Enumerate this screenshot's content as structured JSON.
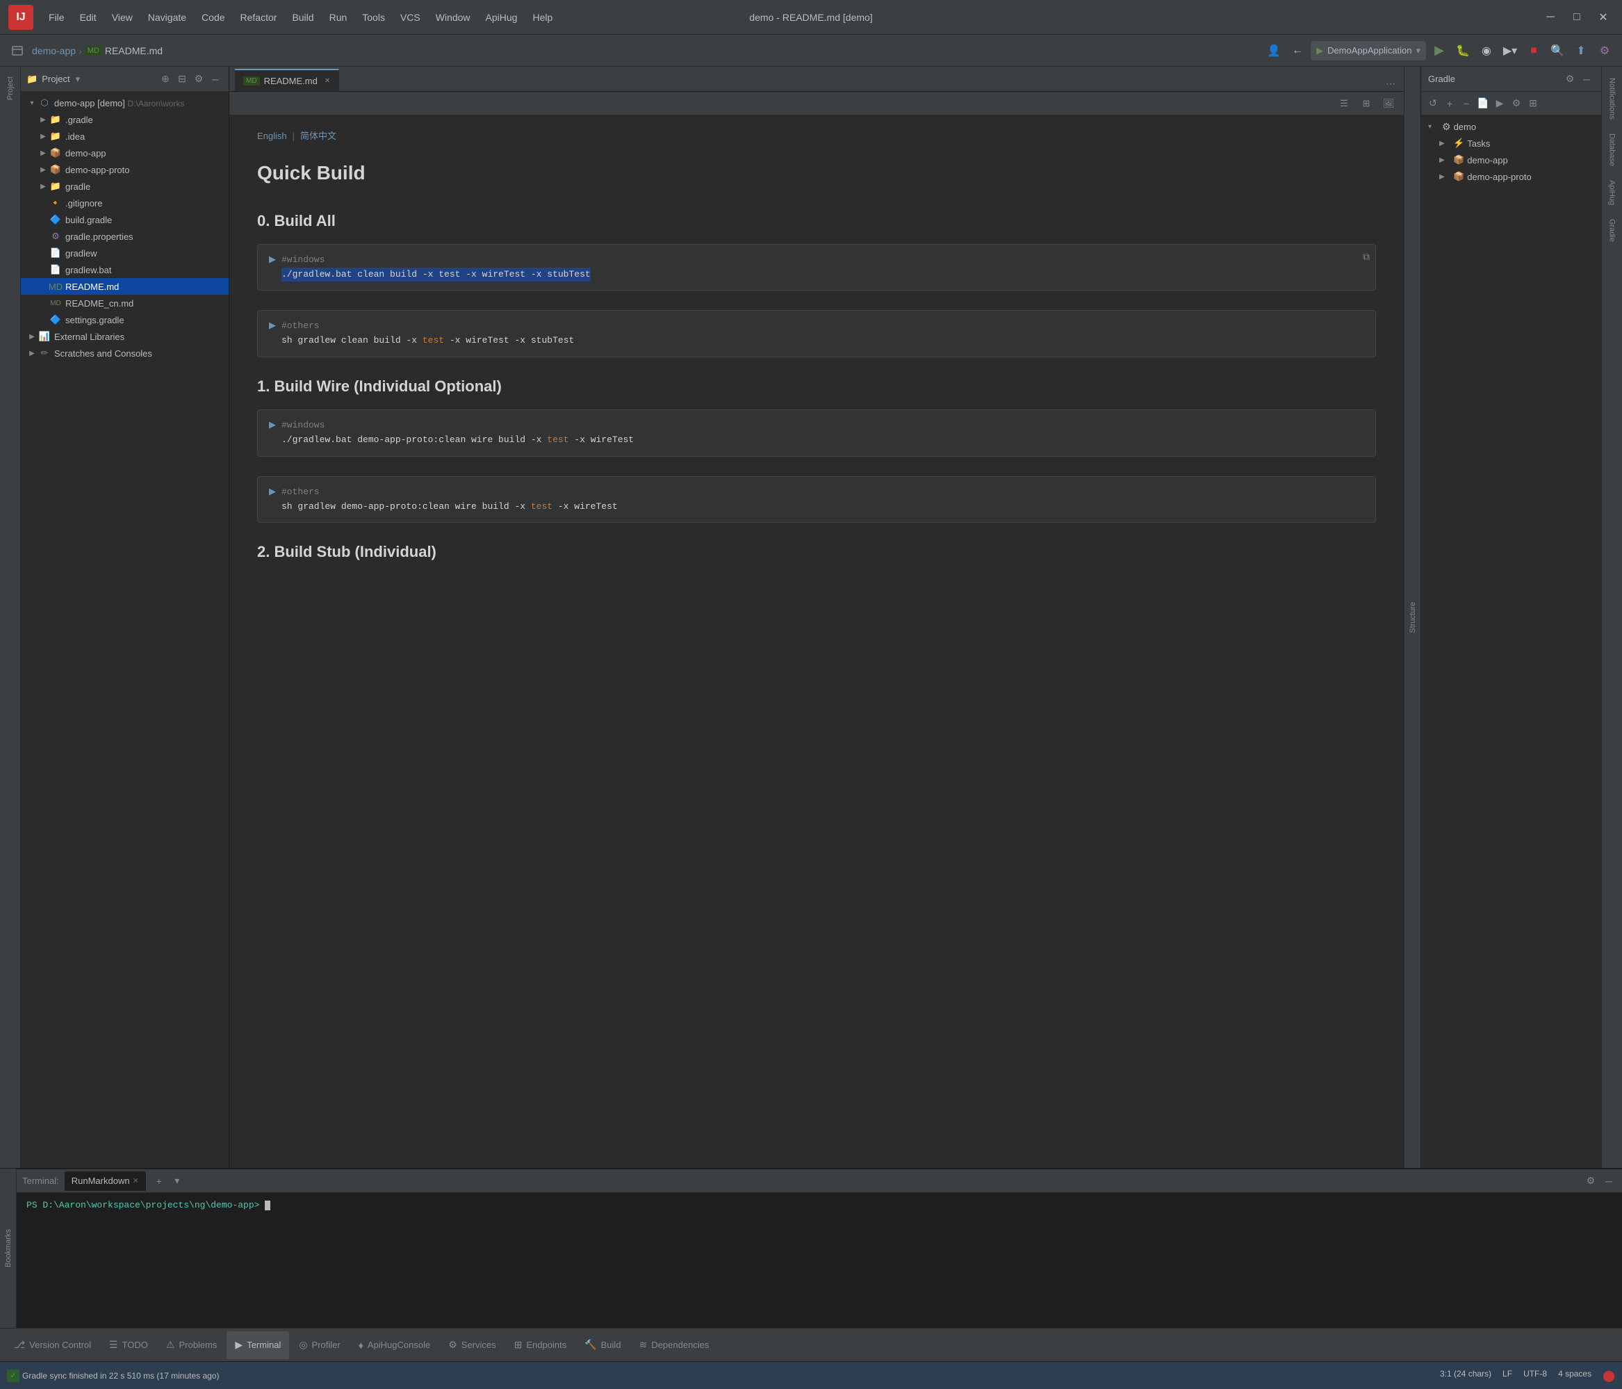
{
  "titleBar": {
    "logo": "IJ",
    "title": "demo - README.md [demo]",
    "menuItems": [
      "File",
      "Edit",
      "View",
      "Navigate",
      "Code",
      "Refactor",
      "Build",
      "Run",
      "Tools",
      "VCS",
      "Window",
      "ApiHug",
      "Help"
    ]
  },
  "navBar": {
    "projectName": "demo-app",
    "fileName": "README.md",
    "appConfig": "DemoAppApplication"
  },
  "projectPanel": {
    "title": "Project",
    "rootNode": {
      "name": "demo-app [demo]",
      "path": "D:\\Aaron\\works"
    },
    "items": [
      {
        "level": 1,
        "name": ".gradle",
        "type": "folder",
        "expanded": false
      },
      {
        "level": 1,
        "name": ".idea",
        "type": "folder",
        "expanded": false
      },
      {
        "level": 1,
        "name": "demo-app",
        "type": "module-folder",
        "expanded": false
      },
      {
        "level": 1,
        "name": "demo-app-proto",
        "type": "module-folder",
        "expanded": false
      },
      {
        "level": 1,
        "name": "gradle",
        "type": "folder",
        "expanded": false
      },
      {
        "level": 1,
        "name": ".gitignore",
        "type": "git",
        "expanded": false
      },
      {
        "level": 1,
        "name": "build.gradle",
        "type": "gradle",
        "expanded": false
      },
      {
        "level": 1,
        "name": "gradle.properties",
        "type": "properties",
        "expanded": false
      },
      {
        "level": 1,
        "name": "gradlew",
        "type": "file",
        "expanded": false
      },
      {
        "level": 1,
        "name": "gradlew.bat",
        "type": "bat",
        "expanded": false
      },
      {
        "level": 1,
        "name": "README.md",
        "type": "md",
        "expanded": false,
        "selected": true
      },
      {
        "level": 1,
        "name": "README_cn.md",
        "type": "md",
        "expanded": false
      },
      {
        "level": 1,
        "name": "settings.gradle",
        "type": "gradle",
        "expanded": false
      },
      {
        "level": 0,
        "name": "External Libraries",
        "type": "folder",
        "expanded": false
      },
      {
        "level": 0,
        "name": "Scratches and Consoles",
        "type": "folder",
        "expanded": false
      }
    ]
  },
  "editorTabs": [
    {
      "name": "README.md",
      "active": true,
      "type": "md"
    }
  ],
  "editorContent": {
    "langLinks": [
      "English",
      "简体中文"
    ],
    "title": "Quick Build",
    "sections": [
      {
        "heading": "0. Build All",
        "blocks": [
          {
            "comment": "#windows",
            "code": "./gradlew.bat clean build -x test -x wireTest -x stubTest",
            "highlighted": ""
          },
          {
            "comment": "#others",
            "code": "sh gradlew clean build -x ",
            "highlighted": "test",
            "codeAfter": " -x wireTest -x stubTest"
          }
        ]
      },
      {
        "heading": "1. Build Wire (Individual Optional)",
        "blocks": [
          {
            "comment": "#windows",
            "code": "./gradlew.bat demo-app-proto:clean wire build -x ",
            "highlighted": "test",
            "codeAfter": " -x wireTest"
          },
          {
            "comment": "#others",
            "code": "sh gradlew demo-app-proto:clean wire build -x ",
            "highlighted": "test",
            "codeAfter": " -x wireTest"
          }
        ]
      },
      {
        "heading": "2. Build Stub (Individual)",
        "blocks": []
      }
    ]
  },
  "gradlePanel": {
    "title": "Gradle",
    "items": [
      {
        "name": "demo",
        "level": 0,
        "expanded": true
      },
      {
        "name": "Tasks",
        "level": 1,
        "expanded": false
      },
      {
        "name": "demo-app",
        "level": 1,
        "expanded": false
      },
      {
        "name": "demo-app-proto",
        "level": 1,
        "expanded": false
      }
    ]
  },
  "rightStrip": {
    "labels": [
      "Notifications",
      "Database",
      "ApiHug",
      "Gradle"
    ]
  },
  "terminal": {
    "label": "Terminal:",
    "tabs": [
      {
        "name": "RunMarkdown",
        "active": true
      }
    ],
    "content": "PS D:\\Aaron\\workspace\\projects\\ng\\demo-app> "
  },
  "bottomTabs": [
    {
      "icon": "⎇",
      "label": "Version Control"
    },
    {
      "icon": "☰",
      "label": "TODO"
    },
    {
      "icon": "⚠",
      "label": "Problems"
    },
    {
      "icon": "▶",
      "label": "Terminal",
      "active": true
    },
    {
      "icon": "◎",
      "label": "Profiler"
    },
    {
      "icon": "♦",
      "label": "ApiHugConsole"
    },
    {
      "icon": "⚙",
      "label": "Services"
    },
    {
      "icon": "⊞",
      "label": "Endpoints"
    },
    {
      "icon": "🔨",
      "label": "Build"
    },
    {
      "icon": "≋",
      "label": "Dependencies"
    }
  ],
  "statusBar": {
    "syncMessage": "Gradle sync finished in 22 s 510 ms (17 minutes ago)",
    "position": "3:1 (24 chars)",
    "lineEnding": "LF",
    "encoding": "UTF-8",
    "indent": "4 spaces"
  },
  "structure": {
    "label": "Structure"
  },
  "bookmarks": {
    "label": "Bookmarks"
  }
}
